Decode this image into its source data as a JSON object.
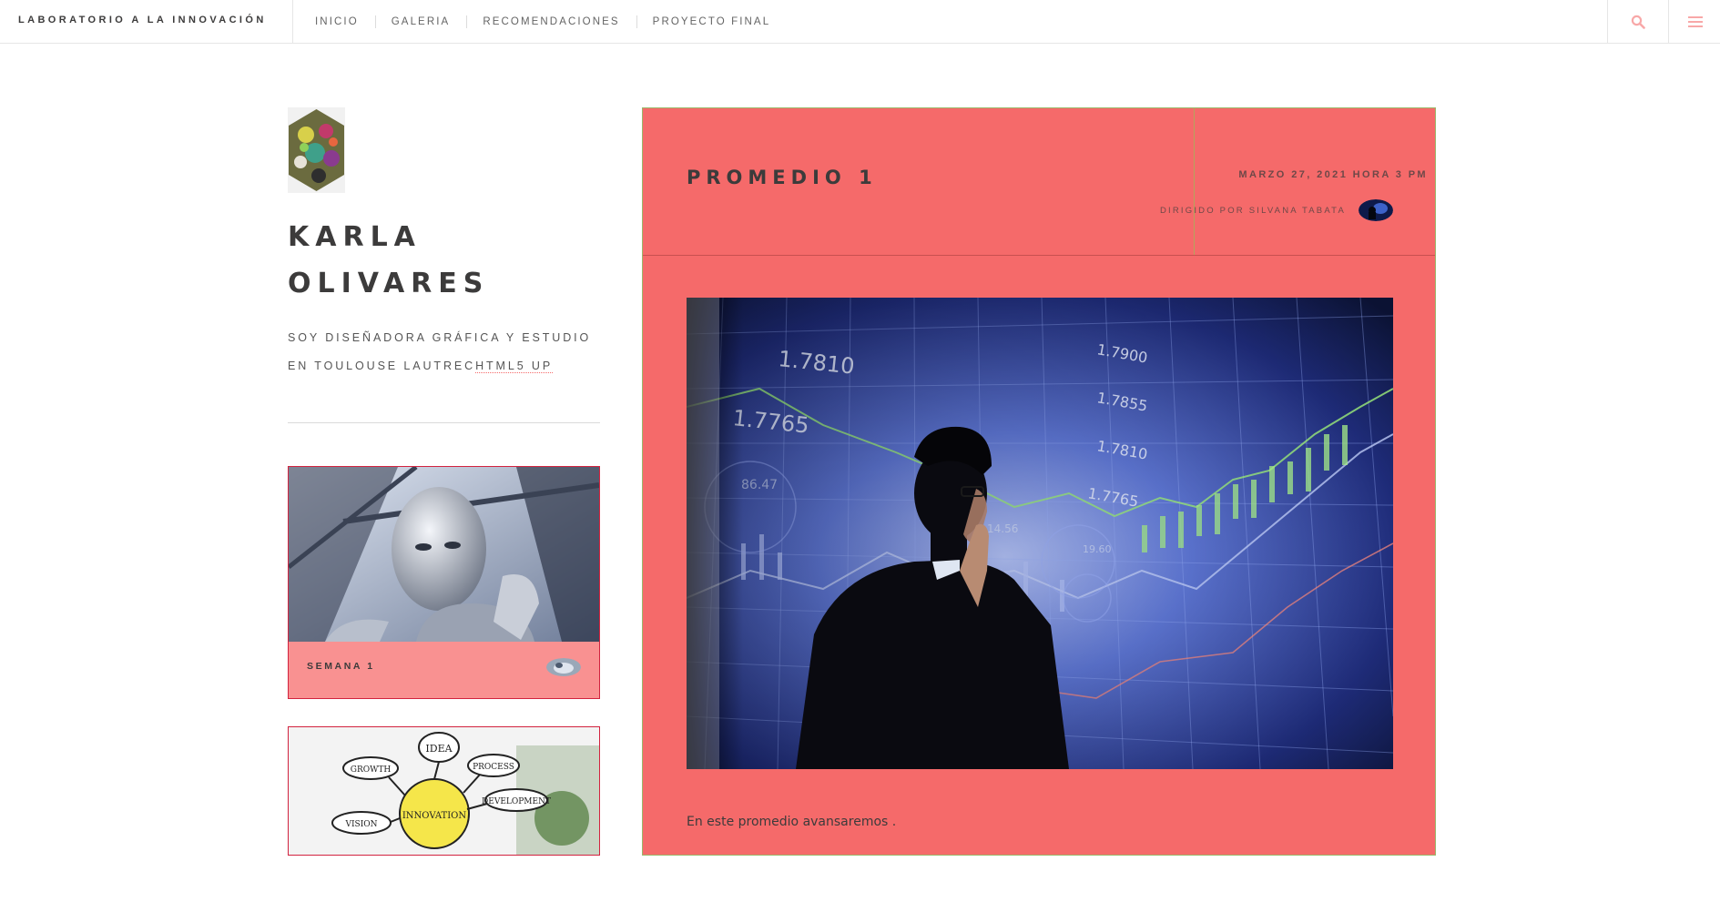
{
  "site": {
    "brand": "LABORATORIO A LA INNOVACIÓN",
    "nav": [
      {
        "label": "INICIO"
      },
      {
        "label": "GALERIA"
      },
      {
        "label": "RECOMENDACIONES"
      },
      {
        "label": "PROYECTO FINAL"
      }
    ],
    "icons": {
      "search": "search-icon",
      "menu": "bars-icon"
    },
    "accent_color": "#f56a6a"
  },
  "sidebar": {
    "avatar_icon": "hexagon-collage-avatar",
    "name_line1": "KARLA",
    "name_line2": "OLIVARES",
    "bio_text": "SOY DISEÑADORA GRÁFICA Y ESTUDIO EN TOULOUSE LAUTREC",
    "bio_link": "HTML5 UP",
    "mini_posts": [
      {
        "title": "SEMANA 1",
        "image": "robot-thinking-photo"
      },
      {
        "title": "",
        "image": "innovation-mindmap-photo"
      }
    ]
  },
  "post": {
    "title": "PROMEDIO 1",
    "date": "MARZO 27, 2021 HORA 3 PM",
    "author": "DIRIGIDO POR SILVANA TABATA",
    "image": "businessman-stock-chart-photo",
    "body": "En este promedio avansaremos ."
  }
}
